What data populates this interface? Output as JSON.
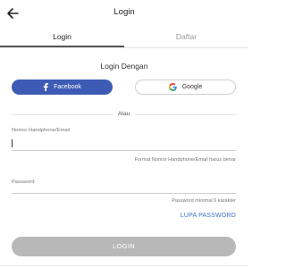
{
  "header": {
    "back_icon": "arrow-left-icon",
    "title": "Login"
  },
  "tabs": [
    {
      "label": "Login",
      "active": true
    },
    {
      "label": "Daftar",
      "active": false
    }
  ],
  "social": {
    "heading": "Login Dengan",
    "facebook_label": "Facebook",
    "facebook_icon": "facebook-icon",
    "facebook_color": "#3d5ab5",
    "google_label": "Google",
    "google_icon": "google-icon"
  },
  "divider_text": "Atau",
  "form": {
    "phone_email": {
      "label": "Nomor Handphone/Email",
      "value": "",
      "hint": "Format Nomor Handphone/Email harus benar"
    },
    "password": {
      "label": "Password",
      "value": "",
      "hint": "Password minimal 6 karakter"
    },
    "forgot_label": "LUPA PASSWORD",
    "submit_label": "LOGIN"
  },
  "colors": {
    "accent_link": "#3d72c7",
    "button_disabled": "#b8b8b8"
  }
}
